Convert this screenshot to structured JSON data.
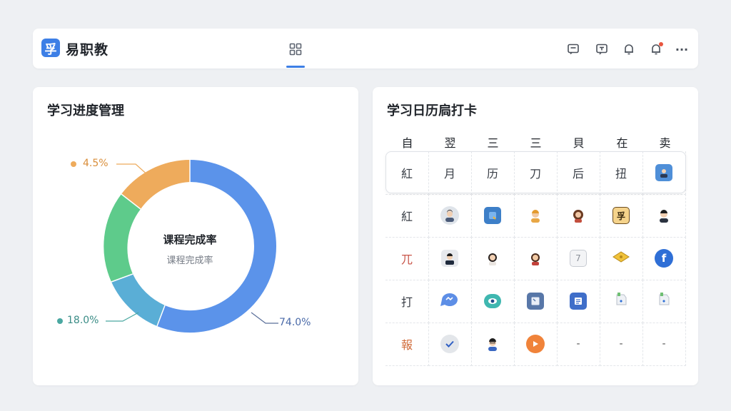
{
  "app": {
    "logo_char": "孚",
    "brand": "易职教"
  },
  "header": {
    "icons": [
      "grid-icon",
      "message-icon",
      "chat-icon",
      "bell-icon",
      "bell-alert-icon",
      "more-icon"
    ],
    "more_label": "···"
  },
  "left_panel": {
    "title": "学习进度管理",
    "center_title": "课程完成率",
    "center_subtitle": "课程完成率",
    "label_top": "4.5%",
    "label_left": "18.0%",
    "label_right": "74.0%"
  },
  "chart_data": {
    "type": "pie",
    "slices": [
      {
        "value": 74.0,
        "color": "#5b93ea"
      },
      {
        "value": 18.0,
        "color": "#5aaed6"
      },
      {
        "value": 22.0,
        "color": "#5ecb8b"
      },
      {
        "value": 4.5,
        "color": "#eeab5c"
      }
    ],
    "labels": [
      "74.0%",
      "18.0%",
      "4.5%"
    ]
  },
  "right_panel": {
    "title": "学习日历扃打卡",
    "weekdays": [
      "自",
      "翌",
      "三",
      "三",
      "貝",
      "在",
      "卖"
    ],
    "rows": [
      [
        "紅",
        "月",
        "历",
        "刀",
        "后",
        "扭",
        "avatar"
      ],
      [
        "紅",
        "avatar",
        "badge",
        "avatar",
        "avatar",
        "stamp",
        "avatar"
      ],
      [
        "兀",
        "avatar",
        "avatar",
        "avatar",
        "calendar",
        "ticket",
        "facebook"
      ],
      [
        "打",
        "bubble",
        "eye",
        "square",
        "doc",
        "tag",
        "tag"
      ],
      [
        "報",
        "check",
        "avatar",
        "play",
        "-",
        "-",
        "-"
      ]
    ]
  },
  "colors": {
    "accent": "#3d7fe6",
    "orange": "#eeab5c",
    "teal": "#4aa8a1",
    "blue_label": "#4a6aa8",
    "red_label": "#c9574b"
  }
}
